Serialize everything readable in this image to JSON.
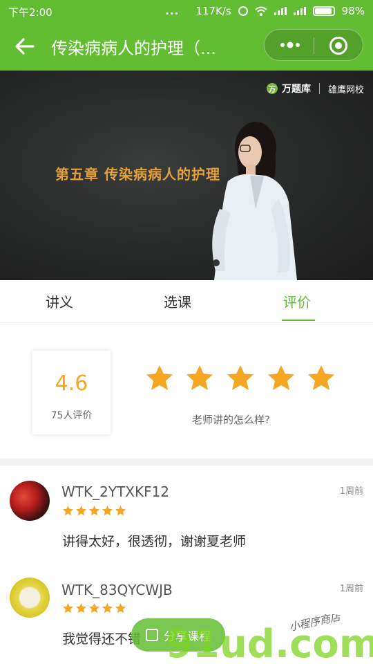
{
  "status_bar": {
    "time": "下午2:00",
    "dots": "...",
    "speed": "117K/s",
    "battery": "98%"
  },
  "nav": {
    "title": "传染病病人的护理（..."
  },
  "video": {
    "brand_logo": "万题库",
    "brand_school": "雄鹰网校",
    "chapter_title": "第五章  传染病病人的护理"
  },
  "tabs": [
    {
      "label": "讲义",
      "active": false
    },
    {
      "label": "选课",
      "active": false
    },
    {
      "label": "评价",
      "active": true
    }
  ],
  "rating": {
    "score": "4.6",
    "count_label": "75人评价",
    "stars": 5,
    "prompt": "老师讲的怎么样?"
  },
  "reviews": [
    {
      "user": "WTK_2YTXKF12",
      "time": "1周前",
      "stars": 5,
      "text": "讲得太好，很透彻，谢谢夏老师"
    },
    {
      "user": "WTK_83QYCWJB",
      "time": "1周前",
      "stars": 5,
      "text": "我觉得还不错"
    }
  ],
  "share": {
    "label": "分享课程"
  },
  "watermark": {
    "text": "91ud.com",
    "slogan": "小程序商店"
  },
  "colors": {
    "brand_green": "#62bd33",
    "star": "#f5a623"
  },
  "icons": [
    "back-arrow-icon",
    "more-dots-icon",
    "close-target-icon",
    "star-icon",
    "share-icon"
  ]
}
